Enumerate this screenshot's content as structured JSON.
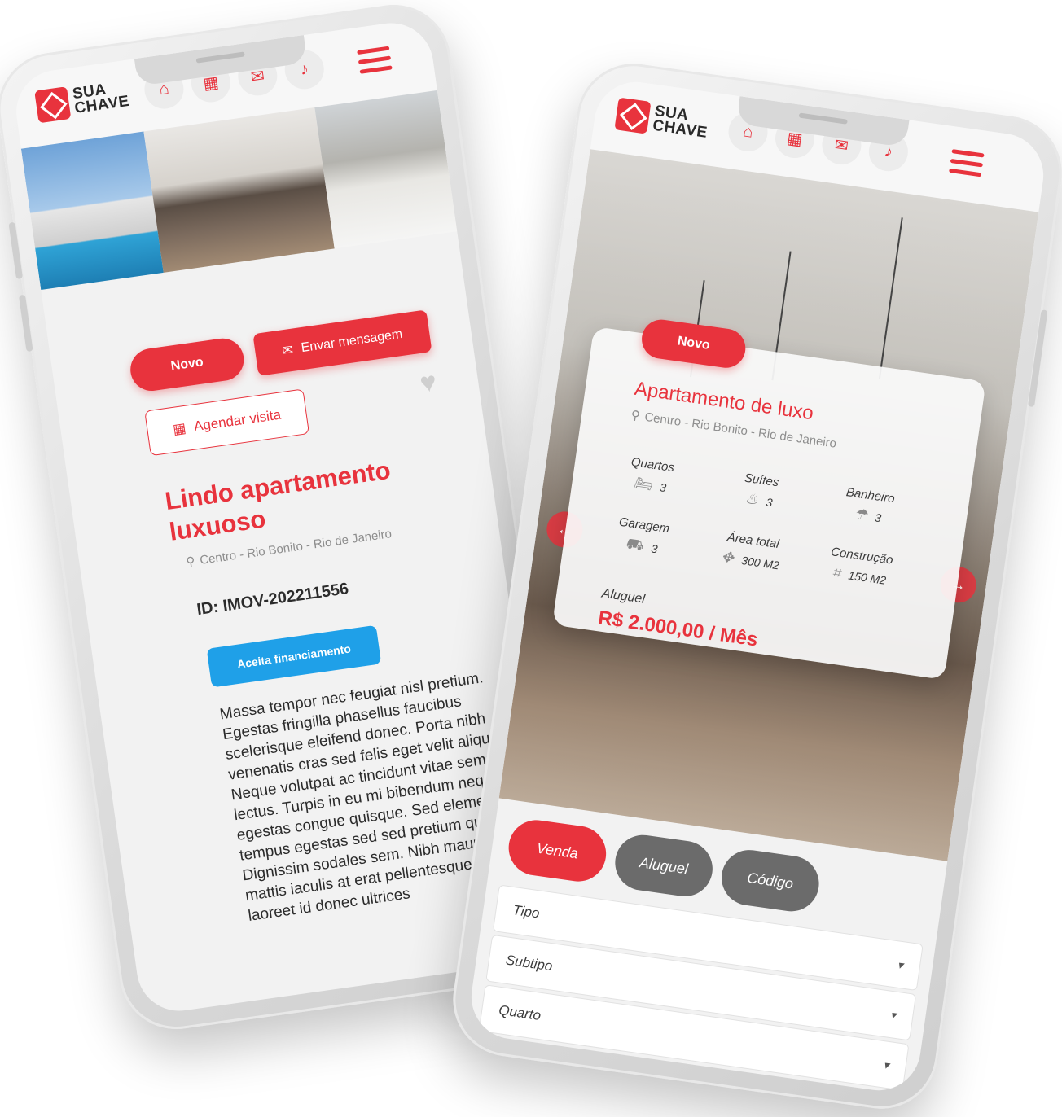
{
  "brand": {
    "line1": "SUA",
    "line2": "CHAVE"
  },
  "nav_icons": [
    "home-icon",
    "calendar-icon",
    "chat-icon",
    "bell-icon"
  ],
  "colors": {
    "accent": "#e8333d",
    "blue": "#1fa0e8",
    "dark_tab": "#6b6b6b"
  },
  "phoneA": {
    "buttons": {
      "novo": "Novo",
      "message": "Envar mensagem",
      "schedule": "Agendar visita"
    },
    "title": "Lindo apartamento luxuoso",
    "location": "Centro - Rio Bonito - Rio de Janeiro",
    "id": "ID: IMOV-202211556",
    "badge": "Aceita financiamento",
    "description": "Massa tempor nec feugiat nisl pretium. Egestas fringilla phasellus faucibus scelerisque eleifend donec. Porta nibh venenatis cras sed felis eget velit aliquet. Neque volutpat ac tincidunt vitae semper quis lectus. Turpis in eu mi bibendum neque egestas congue quisque. Sed elementum tempus egestas sed sed pretium quam. Dignissim sodales sem. Nibh mauris cursus mattis iaculis at erat pellentesque. Id velit laoreet id donec ultrices"
  },
  "phoneB": {
    "card": {
      "badge": "Novo",
      "title": "Apartamento de luxo",
      "location": "Centro - Rio Bonito - Rio de Janeiro",
      "specs": [
        {
          "label": "Quartos",
          "value": "3",
          "icon": "bed-icon"
        },
        {
          "label": "Suítes",
          "value": "3",
          "icon": "bathtub-icon"
        },
        {
          "label": "Banheiro",
          "value": "3",
          "icon": "shower-icon"
        },
        {
          "label": "Garagem",
          "value": "3",
          "icon": "car-icon"
        },
        {
          "label": "Área total",
          "value": "300 M2",
          "icon": "move-icon"
        },
        {
          "label": "Construção",
          "value": "150 M2",
          "icon": "crop-icon"
        }
      ],
      "price_label": "Aluguel",
      "price": "R$ 2.000,00 / Mês"
    },
    "tabs": [
      "Venda",
      "Aluguel",
      "Código"
    ],
    "selects": [
      "Tipo",
      "Subtipo",
      "Quarto"
    ]
  }
}
